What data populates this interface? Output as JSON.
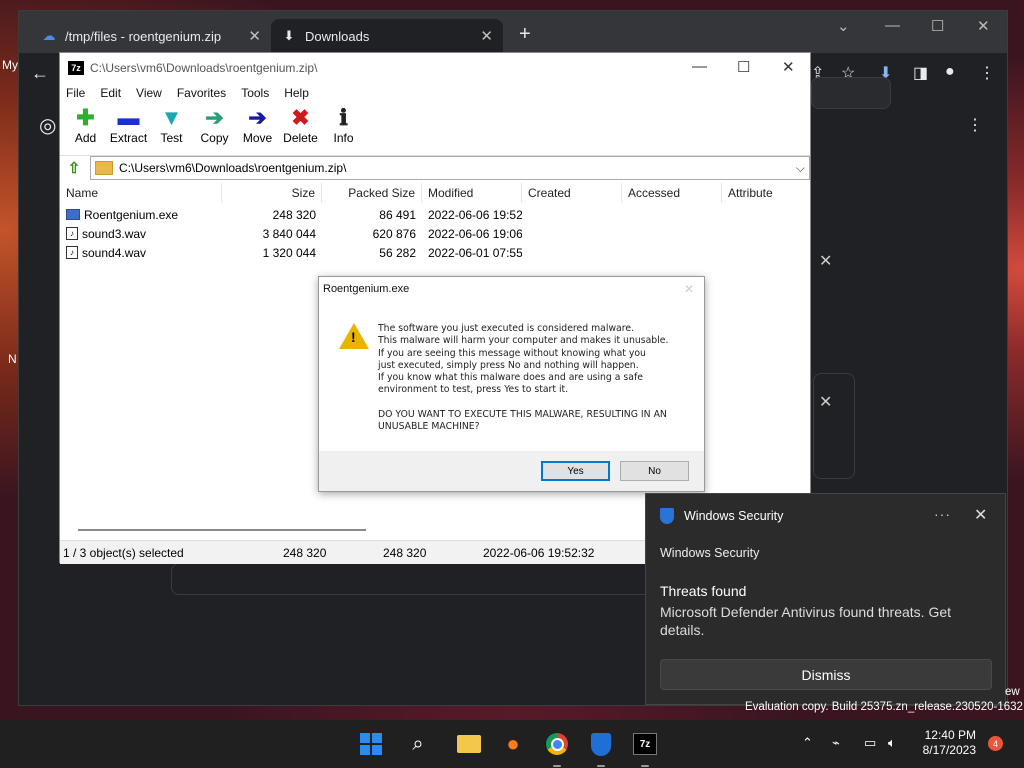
{
  "browser": {
    "tabs": [
      {
        "label": "/tmp/files - roentgenium.zip"
      },
      {
        "label": "Downloads"
      }
    ],
    "side_text_left": "My",
    "side_text_n": "N"
  },
  "sevenzip": {
    "title": "C:\\Users\\vm6\\Downloads\\roentgenium.zip\\",
    "menu": [
      "File",
      "Edit",
      "View",
      "Favorites",
      "Tools",
      "Help"
    ],
    "toolbar": [
      "Add",
      "Extract",
      "Test",
      "Copy",
      "Move",
      "Delete",
      "Info"
    ],
    "address": "C:\\Users\\vm6\\Downloads\\roentgenium.zip\\",
    "columns": [
      "Name",
      "Size",
      "Packed Size",
      "Modified",
      "Created",
      "Accessed",
      "Attribute"
    ],
    "files": [
      {
        "name": "Roentgenium.exe",
        "size": "248 320",
        "packed": "86 491",
        "modified": "2022-06-06 19:52"
      },
      {
        "name": "sound3.wav",
        "size": "3 840 044",
        "packed": "620 876",
        "modified": "2022-06-06 19:06"
      },
      {
        "name": "sound4.wav",
        "size": "1 320 044",
        "packed": "56 282",
        "modified": "2022-06-01 07:55"
      }
    ],
    "status": {
      "selected": "1 / 3 object(s) selected",
      "size": "248 320",
      "packed": "248 320",
      "modified": "2022-06-06 19:52:32"
    }
  },
  "dialog": {
    "title": "Roentgenium.exe",
    "lines": [
      "The software you just executed is considered malware.",
      "This malware will harm your computer and makes it unusable.",
      "If you are seeing this message without knowing what you",
      "just executed, simply press No and nothing will happen.",
      "If you know what this malware does and are using a safe",
      "environment to test, press Yes to start it."
    ],
    "question_lines": [
      "DO YOU WANT TO EXECUTE THIS MALWARE, RESULTING IN AN",
      "UNUSABLE MACHINE?"
    ],
    "yes": "Yes",
    "no": "No"
  },
  "toast": {
    "header": "Windows Security",
    "dots": "···",
    "app": "Windows Security",
    "heading": "Threats found",
    "text": "Microsoft Defender Antivirus found threats. Get details.",
    "dismiss": "Dismiss"
  },
  "desktop": {
    "watermark": "Evaluation copy. Build 25375.zn_release.230520-1632",
    "watermark_right": "ew"
  },
  "taskbar": {
    "time": "12:40 PM",
    "date": "8/17/2023",
    "notifications": "4"
  }
}
